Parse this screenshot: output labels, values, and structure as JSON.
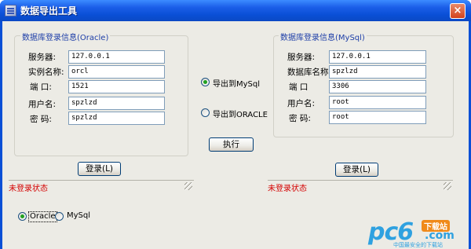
{
  "window": {
    "title": "数据导出工具",
    "close_glyph": "×"
  },
  "oracle_group": {
    "legend": "数据库登录信息(Oracle)",
    "fields": [
      {
        "label": "服务器:",
        "value": "127.0.0.1"
      },
      {
        "label": "实例名称:",
        "value": "orcl"
      },
      {
        "label": "端  口:",
        "value": "1521"
      },
      {
        "label": "用户名:",
        "value": "spzlzd"
      },
      {
        "label": "密  码:",
        "value": "spzlzd"
      }
    ],
    "login_button": "登录(L)",
    "status": "未登录状态"
  },
  "mysql_group": {
    "legend": "数据库登录信息(MySql)",
    "fields": [
      {
        "label": "服务器:",
        "value": "127.0.0.1"
      },
      {
        "label": "数据库名称",
        "value": "spzlzd"
      },
      {
        "label": "端  口",
        "value": "3306"
      },
      {
        "label": "用户名:",
        "value": "root"
      },
      {
        "label": "密  码:",
        "value": "root"
      }
    ],
    "login_button": "登录(L)",
    "status": "未登录状态"
  },
  "export_options": [
    {
      "label": "导出到MySql",
      "checked": true
    },
    {
      "label": "导出到ORACLE",
      "checked": false
    }
  ],
  "execute_button": "执行",
  "source_options": [
    {
      "label": "Oracle",
      "checked": true
    },
    {
      "label": "MySql",
      "checked": false
    }
  ],
  "watermark": {
    "brand": "pc6",
    "badge": "下载站",
    "domain": ".com",
    "slogan": "中国最安全的下载站"
  },
  "colors": {
    "title_bar": "#0a4fd6",
    "legend": "#1d3ea8",
    "status_red": "#d40000",
    "radio_dot": "#21a121"
  }
}
